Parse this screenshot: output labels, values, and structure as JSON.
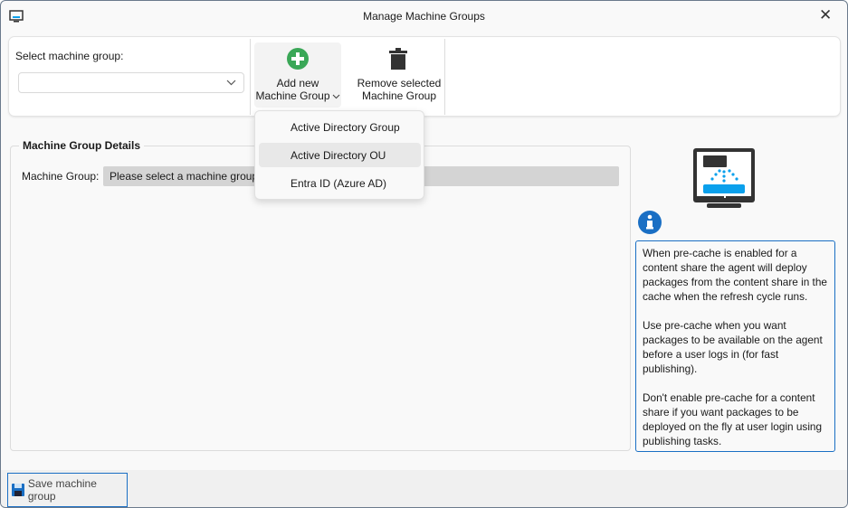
{
  "window": {
    "title": "Manage Machine Groups",
    "close_icon": "close-icon",
    "app_icon": "network-monitor-icon"
  },
  "toolbar": {
    "select_label": "Select machine group:",
    "select_value": "",
    "add_label_line1": "Add new",
    "add_label_line2": "Machine Group",
    "remove_label_line1": "Remove selected",
    "remove_label_line2": "Machine Group"
  },
  "add_menu": {
    "items": [
      {
        "label": "Active Directory Group"
      },
      {
        "label": "Active Directory OU",
        "highlighted": true
      },
      {
        "label": "Entra ID (Azure AD)"
      }
    ]
  },
  "details": {
    "legend": "Machine Group Details",
    "machine_group_label": "Machine Group:",
    "machine_group_value": "Please select a machine group"
  },
  "info": {
    "paragraphs": [
      "When pre-cache is enabled for a content share the agent will deploy packages from the content share in the cache when the refresh cycle runs.",
      "Use pre-cache when you want packages to be available on the agent before a user logs in (for fast publishing).",
      "Don't enable pre-cache for a content share if you want packages to be deployed on the fly at user login using publishing tasks."
    ]
  },
  "footer": {
    "save_label": "Save machine group"
  },
  "colors": {
    "accent": "#1a6fc4",
    "add_green": "#3aa757",
    "diagram_blue": "#0aa0ec"
  }
}
